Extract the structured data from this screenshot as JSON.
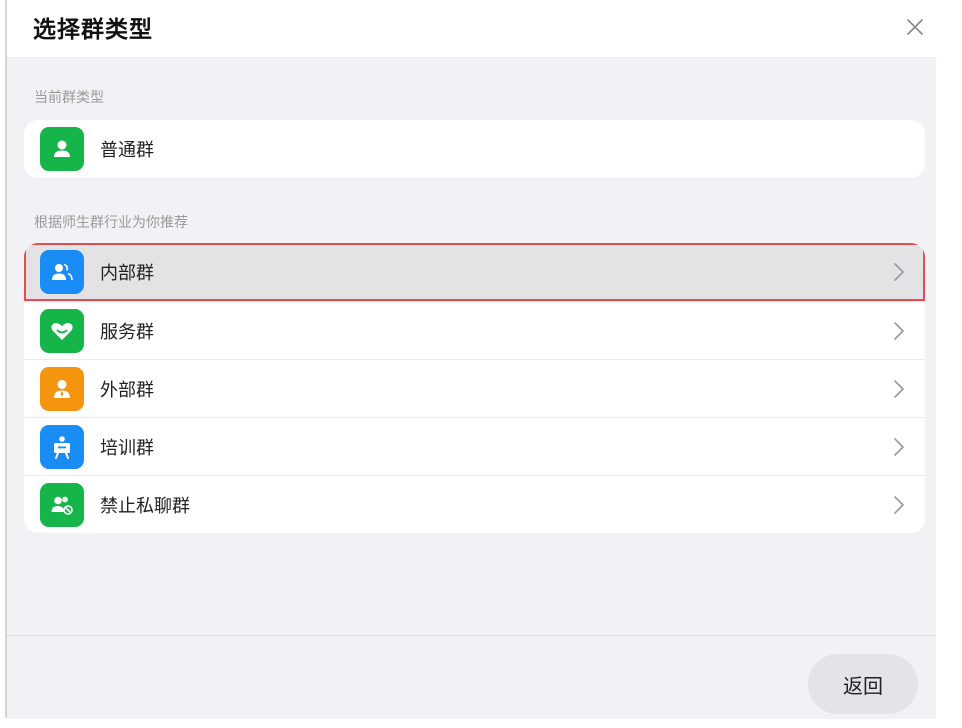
{
  "dialog": {
    "title": "选择群类型",
    "close_icon": "close-icon"
  },
  "current_section": {
    "label": "当前群类型",
    "item": {
      "label": "普通群",
      "icon": "person-icon",
      "color": "#16b54a"
    }
  },
  "recommend_section": {
    "label": "根据师生群行业为你推荐",
    "items": [
      {
        "label": "内部群",
        "icon": "people-icon",
        "color": "#1a8cf5",
        "highlighted": true
      },
      {
        "label": "服务群",
        "icon": "heart-icon",
        "color": "#16b54a"
      },
      {
        "label": "外部群",
        "icon": "person-tie-icon",
        "color": "#f5940e"
      },
      {
        "label": "培训群",
        "icon": "presentation-icon",
        "color": "#1a8cf5"
      },
      {
        "label": "禁止私聊群",
        "icon": "people-blocked-icon",
        "color": "#16b54a"
      }
    ]
  },
  "footer": {
    "back_label": "返回"
  },
  "colors": {
    "highlight_border": "#e84a50",
    "panel_background": "#f2f2f6"
  }
}
